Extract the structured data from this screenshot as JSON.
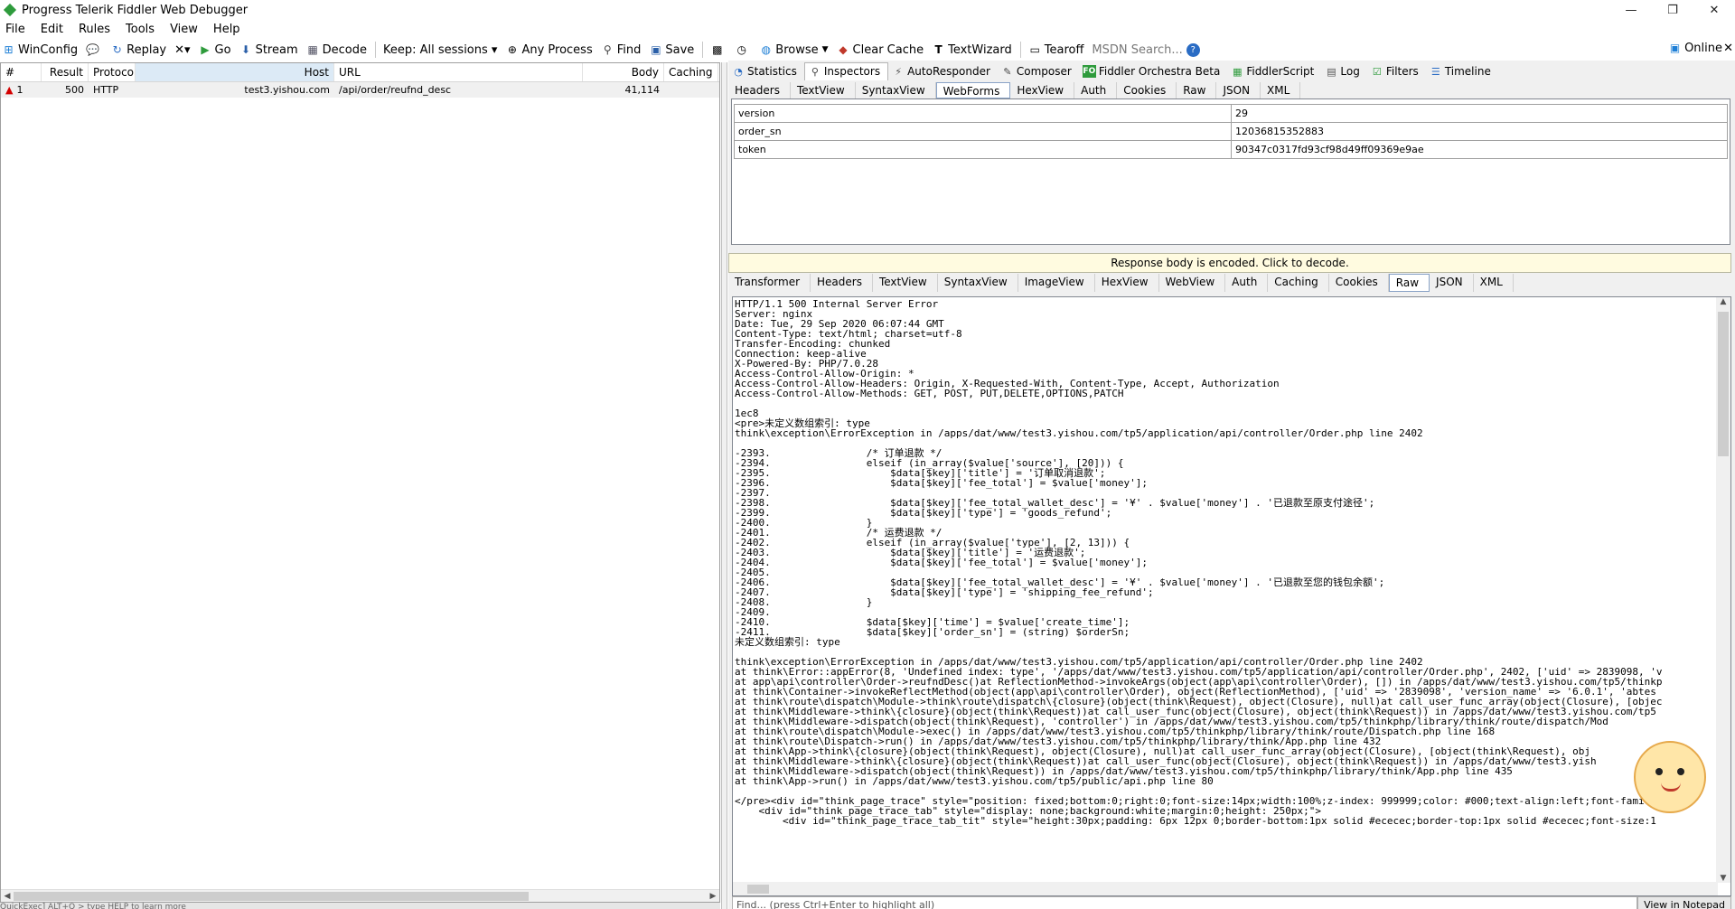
{
  "window": {
    "title": "Progress Telerik Fiddler Web Debugger",
    "controls": [
      "—",
      "❐",
      "✕"
    ]
  },
  "menu": [
    "File",
    "Edit",
    "Rules",
    "Tools",
    "View",
    "Help"
  ],
  "toolbar": {
    "winconfig": "WinConfig",
    "replay": "Replay",
    "remove": "✕▾",
    "go": "Go",
    "stream": "Stream",
    "decode": "Decode",
    "keep": "Keep: All sessions ▾",
    "any_process": "Any Process",
    "find": "Find",
    "save": "Save",
    "browse": "Browse",
    "clear_cache": "Clear Cache",
    "textwizard": "TextWizard",
    "tearoff": "Tearoff",
    "msdn_search": "MSDN Search...",
    "online": "Online"
  },
  "sessions": {
    "columns": [
      "#",
      "Result",
      "Protocol",
      "Host",
      "URL",
      "Body",
      "Caching"
    ],
    "rows": [
      {
        "num": "1",
        "result": "500",
        "protocol": "HTTP",
        "host": "test3.yishou.com",
        "url": "/api/order/reufnd_desc",
        "body": "41,114",
        "caching": ""
      }
    ]
  },
  "inspector_tabs": [
    {
      "label": "Statistics",
      "icon": "statistics-icon",
      "glyph": "◔"
    },
    {
      "label": "Inspectors",
      "icon": "inspectors-icon",
      "glyph": "⚲"
    },
    {
      "label": "AutoResponder",
      "icon": "lightning-icon",
      "glyph": "⚡"
    },
    {
      "label": "Composer",
      "icon": "pencil-icon",
      "glyph": "✎"
    },
    {
      "label": "Fiddler Orchestra Beta",
      "icon": "fo-icon",
      "glyph": "FO"
    },
    {
      "label": "FiddlerScript",
      "icon": "script-icon",
      "glyph": "▦"
    },
    {
      "label": "Log",
      "icon": "log-icon",
      "glyph": "▤"
    },
    {
      "label": "Filters",
      "icon": "checkbox-icon",
      "glyph": "☑"
    },
    {
      "label": "Timeline",
      "icon": "timeline-icon",
      "glyph": "☰"
    }
  ],
  "request_tabs": [
    "Headers",
    "TextView",
    "SyntaxView",
    "WebForms",
    "HexView",
    "Auth",
    "Cookies",
    "Raw",
    "JSON",
    "XML"
  ],
  "webforms": [
    {
      "name": "version",
      "value": "29"
    },
    {
      "name": "order_sn",
      "value": "12036815352883"
    },
    {
      "name": "token",
      "value": "90347c0317fd93cf98d49ff09369e9ae"
    }
  ],
  "encoded_notice": "Response body is encoded. Click to decode.",
  "response_tabs": [
    "Transformer",
    "Headers",
    "TextView",
    "SyntaxView",
    "ImageView",
    "HexView",
    "WebView",
    "Auth",
    "Caching",
    "Cookies",
    "Raw",
    "JSON",
    "XML"
  ],
  "raw_lines": [
    "HTTP/1.1 500 Internal Server Error",
    "Server: nginx",
    "Date: Tue, 29 Sep 2020 06:07:44 GMT",
    "Content-Type: text/html; charset=utf-8",
    "Transfer-Encoding: chunked",
    "Connection: keep-alive",
    "X-Powered-By: PHP/7.0.28",
    "Access-Control-Allow-Origin: *",
    "Access-Control-Allow-Headers: Origin, X-Requested-With, Content-Type, Accept, Authorization",
    "Access-Control-Allow-Methods: GET, POST, PUT,DELETE,OPTIONS,PATCH",
    "",
    "1ec8",
    "<pre>未定义数组索引: type",
    "think\\exception\\ErrorException in /apps/dat/www/test3.yishou.com/tp5/application/api/controller/Order.php line 2402",
    "",
    "-2393.                /* 订单退款 */",
    "-2394.                elseif (in_array($value['source'], [20])) {",
    "-2395.                    $data[$key]['title'] = '订单取消退款';",
    "-2396.                    $data[$key]['fee_total'] = $value['money'];",
    "-2397.",
    "-2398.                    $data[$key]['fee_total_wallet_desc'] = '¥' . $value['money'] . '已退款至原支付途径';",
    "-2399.                    $data[$key]['type'] = 'goods_refund';",
    "-2400.                }",
    "-2401.                /* 运费退款 */",
    "-2402.                elseif (in_array($value['type'], [2, 13])) {",
    "-2403.                    $data[$key]['title'] = '运费退款';",
    "-2404.                    $data[$key]['fee_total'] = $value['money'];",
    "-2405.",
    "-2406.                    $data[$key]['fee_total_wallet_desc'] = '¥' . $value['money'] . '已退款至您的钱包余额';",
    "-2407.                    $data[$key]['type'] = 'shipping_fee_refund';",
    "-2408.                }",
    "-2409.",
    "-2410.                $data[$key]['time'] = $value['create_time'];",
    "-2411.                $data[$key]['order_sn'] = (string) $orderSn;",
    "未定义数组索引: type",
    "",
    "think\\exception\\ErrorException in /apps/dat/www/test3.yishou.com/tp5/application/api/controller/Order.php line 2402",
    "at think\\Error::appError(8, 'Undefined index: type', '/apps/dat/www/test3.yishou.com/tp5/application/api/controller/Order.php', 2402, ['uid' => 2839098, 'v",
    "at app\\api\\controller\\Order->reufndDesc()at ReflectionMethod->invokeArgs(object(app\\api\\controller\\Order), []) in /apps/dat/www/test3.yishou.com/tp5/thinkp",
    "at think\\Container->invokeReflectMethod(object(app\\api\\controller\\Order), object(ReflectionMethod), ['uid' => '2839098', 'version_name' => '6.0.1', 'abtes",
    "at think\\route\\dispatch\\Module->think\\route\\dispatch\\{closure}(object(think\\Request), object(Closure), null)at call_user_func_array(object(Closure), [objec",
    "at think\\Middleware->think\\{closure}(object(think\\Request))at call_user_func(object(Closure), object(think\\Request)) in /apps/dat/www/test3.yishou.com/tp5",
    "at think\\Middleware->dispatch(object(think\\Request), 'controller') in /apps/dat/www/test3.yishou.com/tp5/thinkphp/library/think/route/dispatch/Mod",
    "at think\\route\\dispatch\\Module->exec() in /apps/dat/www/test3.yishou.com/tp5/thinkphp/library/think/route/Dispatch.php line 168",
    "at think\\route\\Dispatch->run() in /apps/dat/www/test3.yishou.com/tp5/thinkphp/library/think/App.php line 432",
    "at think\\App->think\\{closure}(object(think\\Request), object(Closure), null)at call_user_func_array(object(Closure), [object(think\\Request), obj",
    "at think\\Middleware->think\\{closure}(object(think\\Request))at call_user_func(object(Closure), object(think\\Request)) in /apps/dat/www/test3.yish",
    "at think\\Middleware->dispatch(object(think\\Request)) in /apps/dat/www/test3.yishou.com/tp5/thinkphp/library/think/App.php line 435",
    "at think\\App->run() in /apps/dat/www/test3.yishou.com/tp5/public/api.php line 80",
    "",
    "</pre><div id=\"think_page_trace\" style=\"position: fixed;bottom:0;right:0;font-size:14px;width:100%;z-index: 999999;color: #000;text-align:left;font-family",
    "    <div id=\"think_page_trace_tab\" style=\"display: none;background:white;margin:0;height: 250px;\">",
    "        <div id=\"think_page_trace_tab_tit\" style=\"height:30px;padding: 6px 12px 0;border-bottom:1px solid #ececec;border-top:1px solid #ececec;font-size:1"
  ],
  "find_placeholder": "Find... (press Ctrl+Enter to highlight all)",
  "view_in_notepad": "View in Notepad",
  "status_text": "QuickExec] ALT+Q > type HELP to learn more"
}
